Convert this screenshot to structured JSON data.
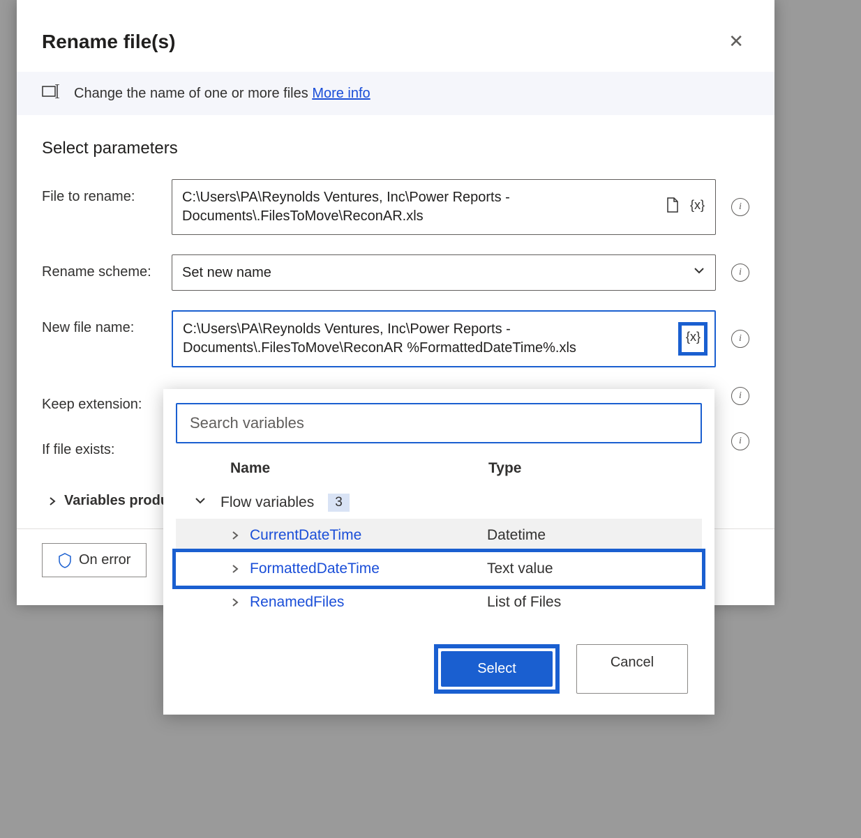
{
  "dialog": {
    "title": "Rename file(s)",
    "info_text": "Change the name of one or more files ",
    "info_link": "More info",
    "section_title": "Select parameters"
  },
  "fields": {
    "file_to_rename": {
      "label": "File to rename:",
      "value": "C:\\Users\\PA\\Reynolds Ventures, Inc\\Power Reports - Documents\\.FilesToMove\\ReconAR.xls"
    },
    "rename_scheme": {
      "label": "Rename scheme:",
      "value": "Set new name"
    },
    "new_file_name": {
      "label": "New file name:",
      "value": "C:\\Users\\PA\\Reynolds Ventures, Inc\\Power Reports - Documents\\.FilesToMove\\ReconAR %FormattedDateTime%.xls"
    },
    "keep_extension": {
      "label": "Keep extension:"
    },
    "if_file_exists": {
      "label": "If file exists:"
    }
  },
  "vars_produced": "Variables produ",
  "on_error_label": "On error",
  "popup": {
    "search_placeholder": "Search variables",
    "col_name": "Name",
    "col_type": "Type",
    "group": {
      "label": "Flow variables",
      "count": "3"
    },
    "rows": [
      {
        "name": "CurrentDateTime",
        "type": "Datetime"
      },
      {
        "name": "FormattedDateTime",
        "type": "Text value"
      },
      {
        "name": "RenamedFiles",
        "type": "List of Files"
      }
    ],
    "select_label": "Select",
    "cancel_label": "Cancel"
  }
}
